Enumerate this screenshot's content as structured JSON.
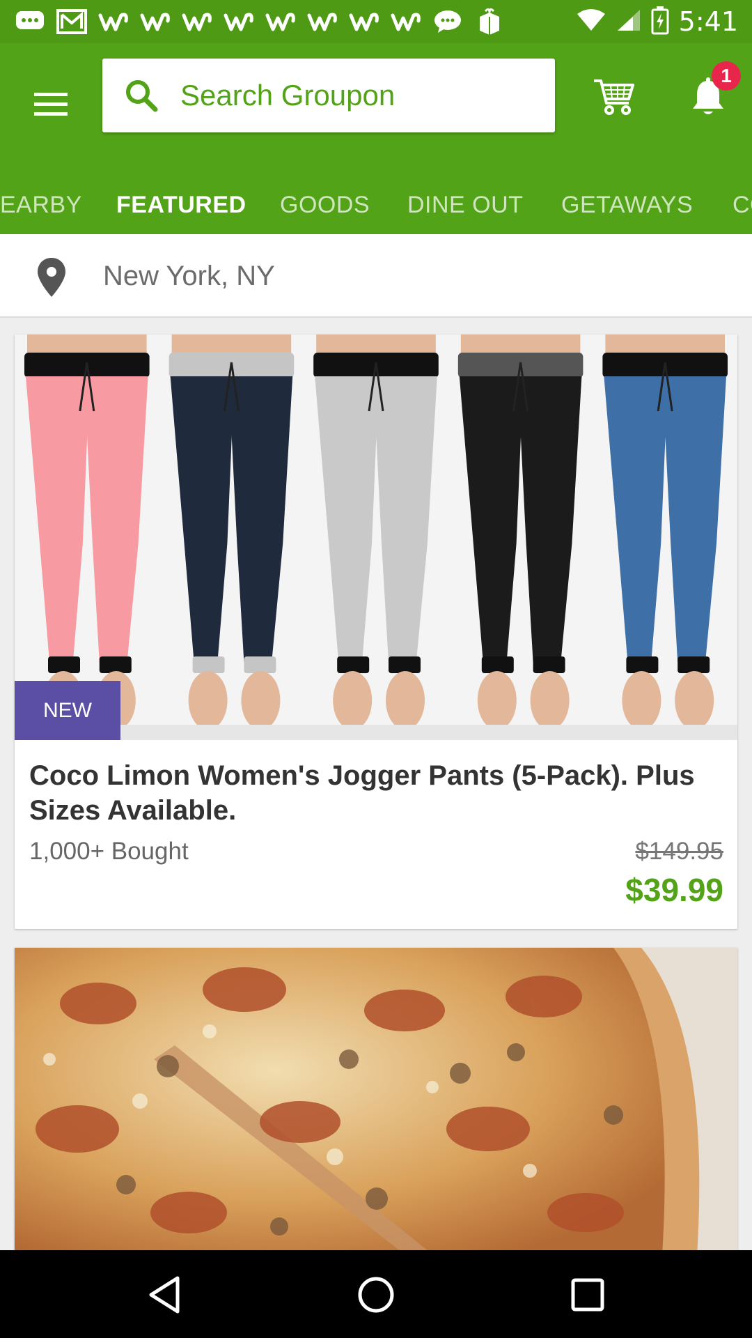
{
  "status_bar": {
    "time": "5:41",
    "icons": [
      "chat-bubble-icon",
      "gmail-icon",
      "wish-app-icon",
      "wish-app-icon",
      "wish-app-icon",
      "wish-app-icon",
      "wish-app-icon",
      "wish-app-icon",
      "wish-app-icon",
      "wish-app-icon",
      "messenger-icon",
      "gift-box-icon",
      "wifi-icon",
      "cell-signal-icon",
      "battery-charging-icon"
    ]
  },
  "header": {
    "search_placeholder": "Search Groupon",
    "notification_count": "1"
  },
  "tabs": [
    {
      "label": "EARBY",
      "active": false
    },
    {
      "label": "FEATURED",
      "active": true
    },
    {
      "label": "GOODS",
      "active": false
    },
    {
      "label": "DINE OUT",
      "active": false
    },
    {
      "label": "GETAWAYS",
      "active": false
    },
    {
      "label": "CO",
      "active": false
    }
  ],
  "location": {
    "text": "New York, NY"
  },
  "deals": [
    {
      "badge": "NEW",
      "title": "Coco Limon Women's Jogger Pants (5-Pack). Plus Sizes Available.",
      "bought": "1,000+ Bought",
      "original_price": "$149.95",
      "price": "$39.99",
      "pant_colors": [
        "#f79aa2",
        "#1f2a3c",
        "#c9c9c9",
        "#1b1b1b",
        "#3e6fa6"
      ]
    },
    {
      "image": "pizza"
    }
  ],
  "colors": {
    "brand_green": "#53a318",
    "status_green": "#4e9a14",
    "badge_purple": "#5b4fa5",
    "notification_red": "#e8264b"
  }
}
